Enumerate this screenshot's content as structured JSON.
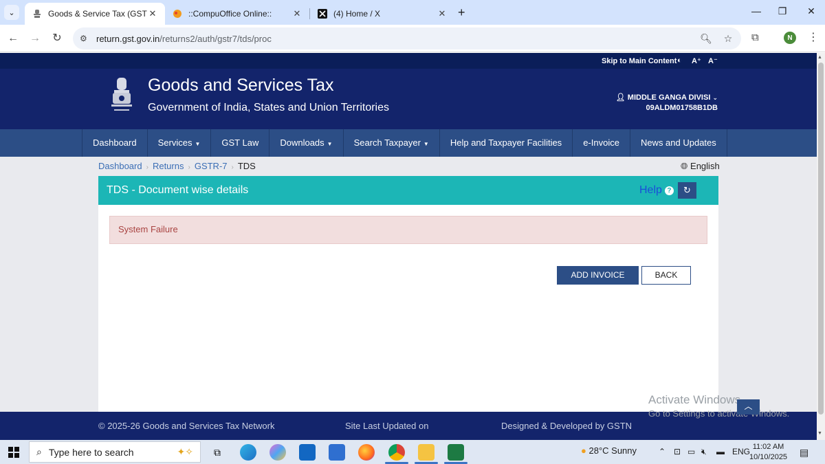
{
  "browser": {
    "tabs": [
      {
        "label": "Goods & Service Tax (GST) |",
        "active": true,
        "favicon": "emblem-icon"
      },
      {
        "label": "::CompuOffice Online::",
        "active": false,
        "favicon": "compuoffice-icon"
      },
      {
        "label": "(4) Home / X",
        "active": false,
        "favicon": "x-logo-icon"
      }
    ],
    "url_domain": "return.gst.gov.in",
    "url_path": "/returns2/auth/gstr7/tds/proc",
    "profile_initial": "N"
  },
  "site": {
    "skip_link": "Skip to Main Content",
    "font_increase": "A⁺",
    "font_decrease": "A⁻",
    "title": "Goods and Services Tax",
    "subtitle": "Government of India, States and Union Territories",
    "user_name": "MIDDLE GANGA DIVISI",
    "user_id": "09ALDM01758B1DB",
    "nav": [
      {
        "label": "Dashboard",
        "dropdown": false
      },
      {
        "label": "Services",
        "dropdown": true
      },
      {
        "label": "GST Law",
        "dropdown": false
      },
      {
        "label": "Downloads",
        "dropdown": true
      },
      {
        "label": "Search Taxpayer",
        "dropdown": true
      },
      {
        "label": "Help and Taxpayer Facilities",
        "dropdown": false
      },
      {
        "label": "e-Invoice",
        "dropdown": false
      },
      {
        "label": "News and Updates",
        "dropdown": false
      }
    ],
    "breadcrumb": [
      "Dashboard",
      "Returns",
      "GSTR-7",
      "TDS"
    ],
    "language": "English"
  },
  "panel": {
    "title": "TDS - Document wise details",
    "help_label": "Help",
    "alert_message": "System Failure",
    "add_button": "ADD INVOICE",
    "back_button": "BACK"
  },
  "footer": {
    "copyright": "© 2025-26 Goods and Services Tax Network",
    "updated": "Site Last Updated on",
    "developer": "Designed & Developed by GSTN"
  },
  "watermark": {
    "line1": "Activate Windows",
    "line2": "Go to Settings to activate Windows."
  },
  "taskbar": {
    "search_placeholder": "Type here to search",
    "weather": "28°C  Sunny",
    "language": "ENG",
    "time": "11:02 AM",
    "date": "10/10/2025"
  },
  "colors": {
    "header_bg": "#13246b",
    "nav_bg": "#2c4e86",
    "panel_header": "#1cb6b6",
    "alert_bg": "#f2dede",
    "alert_text": "#a94442"
  }
}
